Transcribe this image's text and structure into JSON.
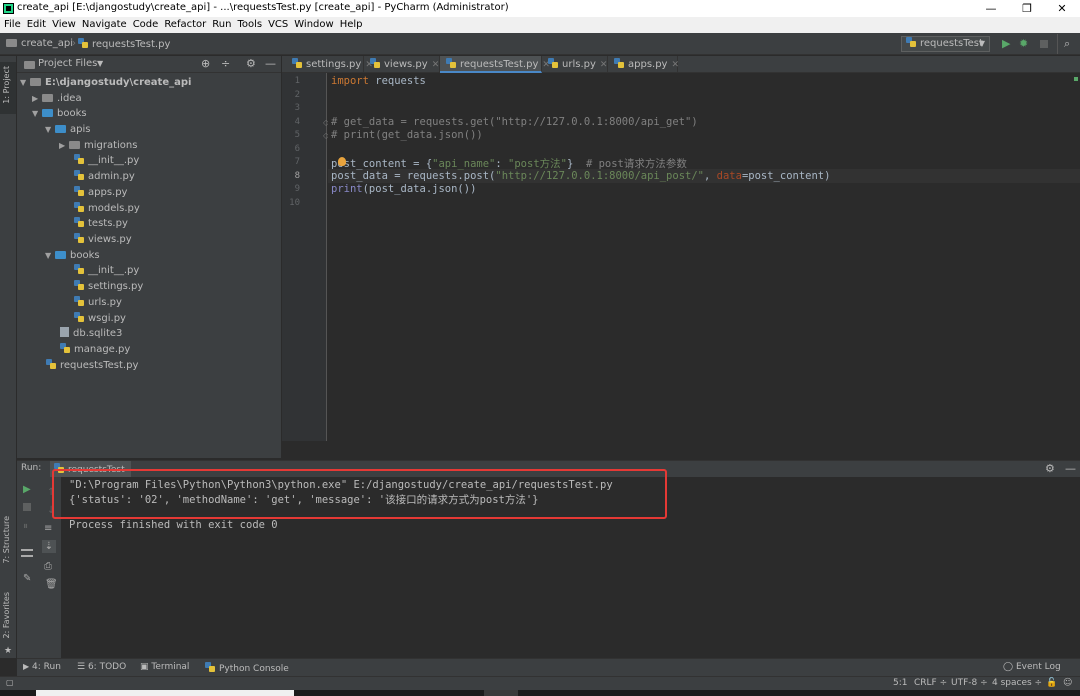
{
  "window": {
    "title": "create_api [E:\\djangostudy\\create_api] - ...\\requestsTest.py [create_api] - PyCharm (Administrator)",
    "minimize": "—",
    "restore": "❐",
    "close": "✕"
  },
  "menu": [
    "File",
    "Edit",
    "View",
    "Navigate",
    "Code",
    "Refactor",
    "Run",
    "Tools",
    "VCS",
    "Window",
    "Help"
  ],
  "breadcrumb": {
    "project": "create_api",
    "file": "requestsTest.py"
  },
  "run_config": {
    "name": "requestsTest"
  },
  "left_stripe": {
    "project": "1: Project",
    "structure": "7: Structure",
    "favorites": "2: Favorites"
  },
  "project_panel": {
    "header": "Project Files"
  },
  "tree": [
    {
      "label": "E:\\djangostudy\\create_api",
      "icon": "folder",
      "arrow": "▼"
    },
    {
      "label": ".idea",
      "icon": "folder",
      "arrow": "▶"
    },
    {
      "label": "books",
      "icon": "folder-blue",
      "arrow": "▼"
    },
    {
      "label": "apis",
      "icon": "folder-blue",
      "arrow": "▼"
    },
    {
      "label": "migrations",
      "icon": "folder",
      "arrow": "▶"
    },
    {
      "label": "__init__.py",
      "icon": "py",
      "arrow": ""
    },
    {
      "label": "admin.py",
      "icon": "py",
      "arrow": ""
    },
    {
      "label": "apps.py",
      "icon": "py",
      "arrow": ""
    },
    {
      "label": "models.py",
      "icon": "py",
      "arrow": ""
    },
    {
      "label": "tests.py",
      "icon": "py",
      "arrow": ""
    },
    {
      "label": "views.py",
      "icon": "py",
      "arrow": ""
    },
    {
      "label": "books",
      "icon": "folder-blue",
      "arrow": "▼"
    },
    {
      "label": "__init__.py",
      "icon": "py",
      "arrow": ""
    },
    {
      "label": "settings.py",
      "icon": "py",
      "arrow": ""
    },
    {
      "label": "urls.py",
      "icon": "py",
      "arrow": ""
    },
    {
      "label": "wsgi.py",
      "icon": "py",
      "arrow": ""
    },
    {
      "label": "db.sqlite3",
      "icon": "file",
      "arrow": ""
    },
    {
      "label": "manage.py",
      "icon": "py",
      "arrow": ""
    },
    {
      "label": "requestsTest.py",
      "icon": "py",
      "arrow": ""
    }
  ],
  "tabs": [
    "settings.py",
    "views.py",
    "requestsTest.py",
    "urls.py",
    "apps.py"
  ],
  "code": {
    "line_numbers": [
      "1",
      "2",
      "3",
      "4",
      "5",
      "6",
      "7",
      "8",
      "9",
      "10"
    ],
    "l1_kw": "import",
    "l1_rest": " requests",
    "l4": "# get_data = requests.get(\"http://127.0.0.1:8000/api_get\")",
    "l5": "# print(get_data.json())",
    "l7_a": "post_content = {",
    "l7_s1": "\"api_name\"",
    "l7_b": ": ",
    "l7_s2": "\"post方法\"",
    "l7_c": "}  ",
    "l7_cm": "# post请求方法参数",
    "l8_a": "post_data = requests.post(",
    "l8_s": "\"http://127.0.0.1:8000/api_post/\"",
    "l8_b": ", ",
    "l8_p": "data",
    "l8_c": "=post_content)",
    "l9_fn": "print",
    "l9_rest": "(post_data.json())"
  },
  "run_panel": {
    "label": "Run:",
    "tab": "requestsTest"
  },
  "console": {
    "cmd": "\"D:\\Program Files\\Python\\Python3\\python.exe\" E:/djangostudy/create_api/requestsTest.py",
    "output": "{'status': '02', 'methodName': 'get', 'message': '该接口的请求方式为post方法'}",
    "finished": "Process finished with exit code 0"
  },
  "tool_windows": {
    "run": "4: Run",
    "todo": "6: TODO",
    "terminal": "Terminal",
    "python_console": "Python Console",
    "event_log": "Event Log"
  },
  "status": {
    "position": "5:1",
    "line_sep": "CRLF ÷",
    "encoding": "UTF-8 ÷",
    "indent": "4 spaces ÷"
  }
}
